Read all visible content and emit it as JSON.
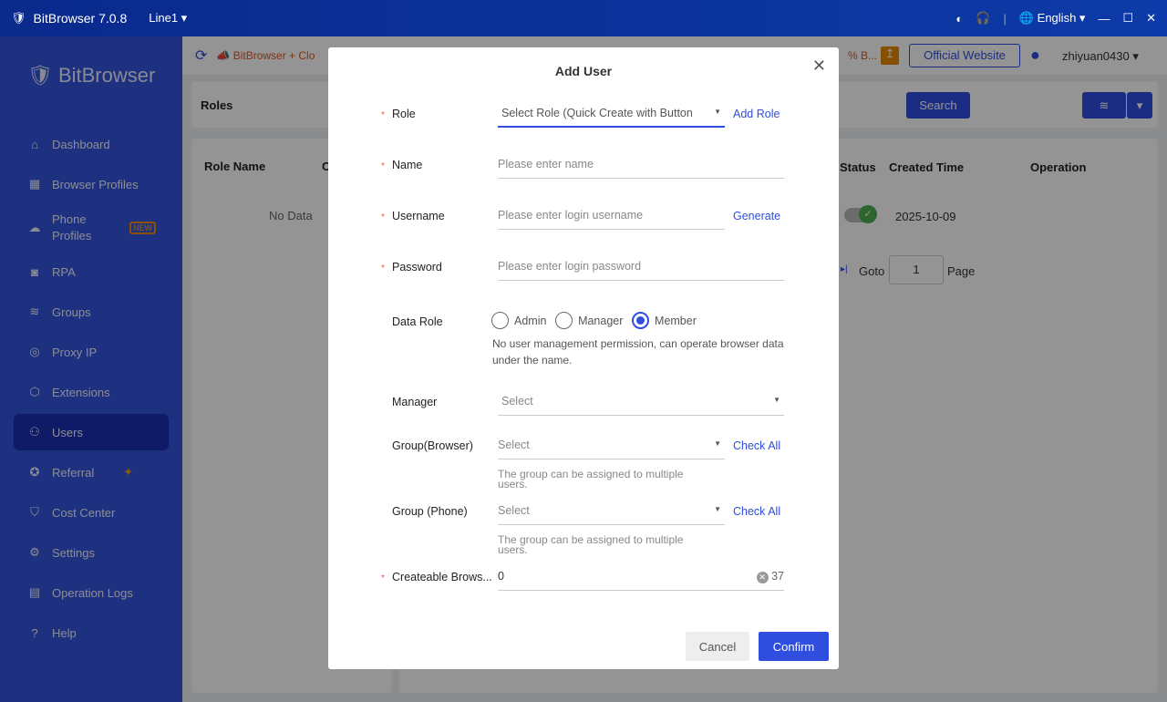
{
  "titlebar": {
    "app": "BitBrowser 7.0.8",
    "line": "Line1",
    "language": "English"
  },
  "sidebar": {
    "logo": "BitBrowser",
    "items": [
      {
        "label": "Dashboard",
        "icon": "home-icon"
      },
      {
        "label": "Browser Profiles",
        "icon": "grid-icon"
      },
      {
        "label": "Phone Profiles",
        "icon": "cloud-icon",
        "badge": "NEW"
      },
      {
        "label": "RPA",
        "icon": "robot-icon"
      },
      {
        "label": "Groups",
        "icon": "layers-icon"
      },
      {
        "label": "Proxy IP",
        "icon": "location-icon"
      },
      {
        "label": "Extensions",
        "icon": "cube-icon"
      },
      {
        "label": "Users",
        "icon": "users-icon",
        "active": true
      },
      {
        "label": "Referral",
        "icon": "gift-icon"
      },
      {
        "label": "Cost Center",
        "icon": "shield-icon"
      },
      {
        "label": "Settings",
        "icon": "gear-icon"
      },
      {
        "label": "Operation Logs",
        "icon": "log-icon"
      },
      {
        "label": "Help",
        "icon": "help-icon"
      }
    ]
  },
  "topbar": {
    "promo": "BitBrowser + Clo",
    "promo_tail": "% B...",
    "official": "Official Website",
    "user": "zhiyuan0430"
  },
  "roles": {
    "title": "Roles",
    "col": "Role Name",
    "col2": "C",
    "empty": "No Data"
  },
  "users": {
    "search": "Search",
    "headers": [
      "Status",
      "Created Time",
      "Operation"
    ],
    "row_date": "2025-10-09",
    "goto": "Goto",
    "page": "1",
    "page_label": "Page"
  },
  "modal": {
    "title": "Add User",
    "role": {
      "label": "Role",
      "placeholder": "Select Role (Quick Create with Button",
      "link": "Add Role"
    },
    "name": {
      "label": "Name",
      "placeholder": "Please enter name"
    },
    "username": {
      "label": "Username",
      "placeholder": "Please enter login username",
      "link": "Generate"
    },
    "password": {
      "label": "Password",
      "placeholder": "Please enter login password"
    },
    "data_role": {
      "label": "Data Role",
      "options": [
        "Admin",
        "Manager",
        "Member"
      ],
      "selected": "Member",
      "hint": "No user management permission, can operate browser data under the name."
    },
    "manager": {
      "label": "Manager",
      "placeholder": "Select"
    },
    "group_browser": {
      "label": "Group(Browser)",
      "placeholder": "Select",
      "link": "Check All",
      "hint1": "The group can be assigned to multiple",
      "hint2": "users."
    },
    "group_phone": {
      "label": "Group (Phone)",
      "placeholder": "Select",
      "link": "Check All",
      "hint1": "The group can be assigned to multiple",
      "hint2": "users."
    },
    "createable": {
      "label": "Createable Brows...",
      "value": "0",
      "max": "37"
    },
    "cancel": "Cancel",
    "confirm": "Confirm"
  }
}
